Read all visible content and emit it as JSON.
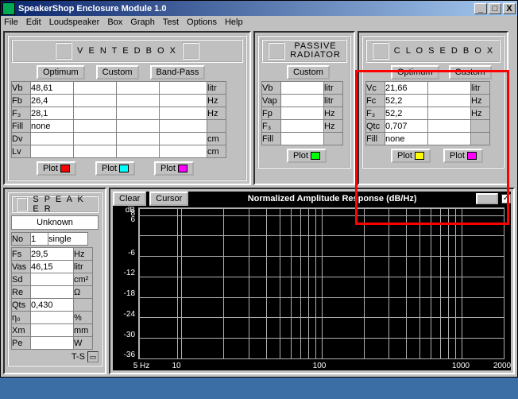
{
  "window": {
    "title": "SpeakerShop Enclosure Module 1.0",
    "min": "_",
    "max": "□",
    "close": "X"
  },
  "menu": [
    "File",
    "Edit",
    "Loudspeaker",
    "Box",
    "Graph",
    "Test",
    "Options",
    "Help"
  ],
  "vented": {
    "title": "V E N T E D   B O X",
    "btn_opt": "Optimum",
    "btn_custom": "Custom",
    "btn_bandpass": "Band-Pass",
    "rows": [
      {
        "label": "Vb",
        "val": "48,61",
        "unit": "litr"
      },
      {
        "label": "Fb",
        "val": "26,4",
        "unit": "Hz"
      },
      {
        "label": "F₃",
        "val": "28,1",
        "unit": "Hz"
      },
      {
        "label": "Fill",
        "val": "none",
        "unit": ""
      },
      {
        "label": "Dv",
        "val": "",
        "unit": "cm"
      },
      {
        "label": "Lv",
        "val": "",
        "unit": "cm"
      }
    ],
    "plot": "Plot",
    "sw1": "#ff0000",
    "sw2": "#00ffff",
    "sw3": "#ff00ff"
  },
  "passive": {
    "title1": "PASSIVE",
    "title2": "RADIATOR",
    "btn_custom": "Custom",
    "rows": [
      {
        "label": "Vb",
        "val": "",
        "unit": "litr"
      },
      {
        "label": "Vap",
        "val": "",
        "unit": "litr"
      },
      {
        "label": "Fp",
        "val": "",
        "unit": "Hz"
      },
      {
        "label": "F₃",
        "val": "",
        "unit": "Hz"
      },
      {
        "label": "Fill",
        "val": "",
        "unit": ""
      }
    ],
    "plot": "Plot",
    "sw": "#00ff00"
  },
  "closed": {
    "title": "C L O S E D   B O X",
    "btn_opt": "Optimum",
    "btn_custom": "Custom",
    "rows": [
      {
        "label": "Vc",
        "val": "21,66",
        "unit": "litr"
      },
      {
        "label": "Fc",
        "val": "52,2",
        "unit": "Hz"
      },
      {
        "label": "F₃",
        "val": "52,2",
        "unit": "Hz"
      },
      {
        "label": "Qtc",
        "val": "0,707",
        "unit": ""
      },
      {
        "label": "Fill",
        "val": "none",
        "unit": ""
      }
    ],
    "plot": "Plot",
    "sw1": "#ffff00",
    "sw2": "#ff00ff"
  },
  "speaker": {
    "title": "S P E A K E R",
    "name": "Unknown",
    "no_lbl": "No",
    "no_val": "1",
    "type": "single",
    "rows": [
      {
        "label": "Fs",
        "val": "29,5",
        "unit": "Hz"
      },
      {
        "label": "Vas",
        "val": "46,15",
        "unit": "litr"
      },
      {
        "label": "Sd",
        "val": "",
        "unit": "cm²"
      },
      {
        "label": "Re",
        "val": "",
        "unit": "Ω"
      },
      {
        "label": "Qts",
        "val": "0,430",
        "unit": ""
      },
      {
        "label": "η₀",
        "val": "",
        "unit": "%"
      },
      {
        "label": "Xm",
        "val": "",
        "unit": "mm"
      },
      {
        "label": "Pe",
        "val": "",
        "unit": "W"
      }
    ],
    "ts": "T-S"
  },
  "chart": {
    "btn_clear": "Clear",
    "btn_cursor": "Cursor",
    "title": "Normalized Amplitude Response (dB/Hz)",
    "check": "✓"
  },
  "chart_data": {
    "type": "line",
    "title": "Normalized Amplitude Response (dB/Hz)",
    "xlabel": "Hz",
    "ylabel": "dB",
    "x_scale": "log",
    "xlim": [
      5,
      2000
    ],
    "ylim": [
      -36,
      8
    ],
    "y_ticks": [
      "dB",
      8,
      6,
      "",
      "-6",
      "-12",
      "-18",
      "-24",
      "-30",
      "-36"
    ],
    "x_ticks": [
      "5 Hz",
      "10",
      "100",
      "1000",
      "2000"
    ],
    "series": []
  }
}
